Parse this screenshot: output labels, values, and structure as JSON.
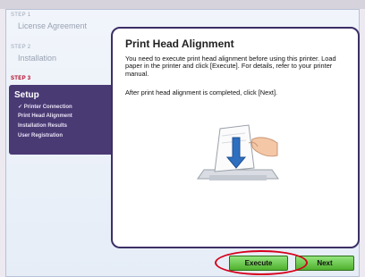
{
  "steps": [
    {
      "tag": "STEP 1",
      "title": "License Agreement"
    },
    {
      "tag": "STEP 2",
      "title": "Installation"
    },
    {
      "tag": "STEP 3",
      "title": "Setup"
    }
  ],
  "setup_items": [
    {
      "label": "✓ Printer Connection"
    },
    {
      "label": "Print Head Alignment"
    },
    {
      "label": "Installation Results"
    },
    {
      "label": "User Registration"
    }
  ],
  "main": {
    "title": "Print Head Alignment",
    "para1": "You need to execute print head alignment before using this printer. Load paper in the printer and click [Execute]. For details, refer to your printer manual.",
    "para2": "After print head alignment is completed, click [Next]."
  },
  "buttons": {
    "execute": "Execute",
    "next": "Next"
  },
  "colors": {
    "accent_purple": "#4a3a74",
    "button_green": "#4fb02e",
    "highlight_red": "#d6001c"
  },
  "icons": {
    "illustration": "paper-load-illustration-icon"
  }
}
